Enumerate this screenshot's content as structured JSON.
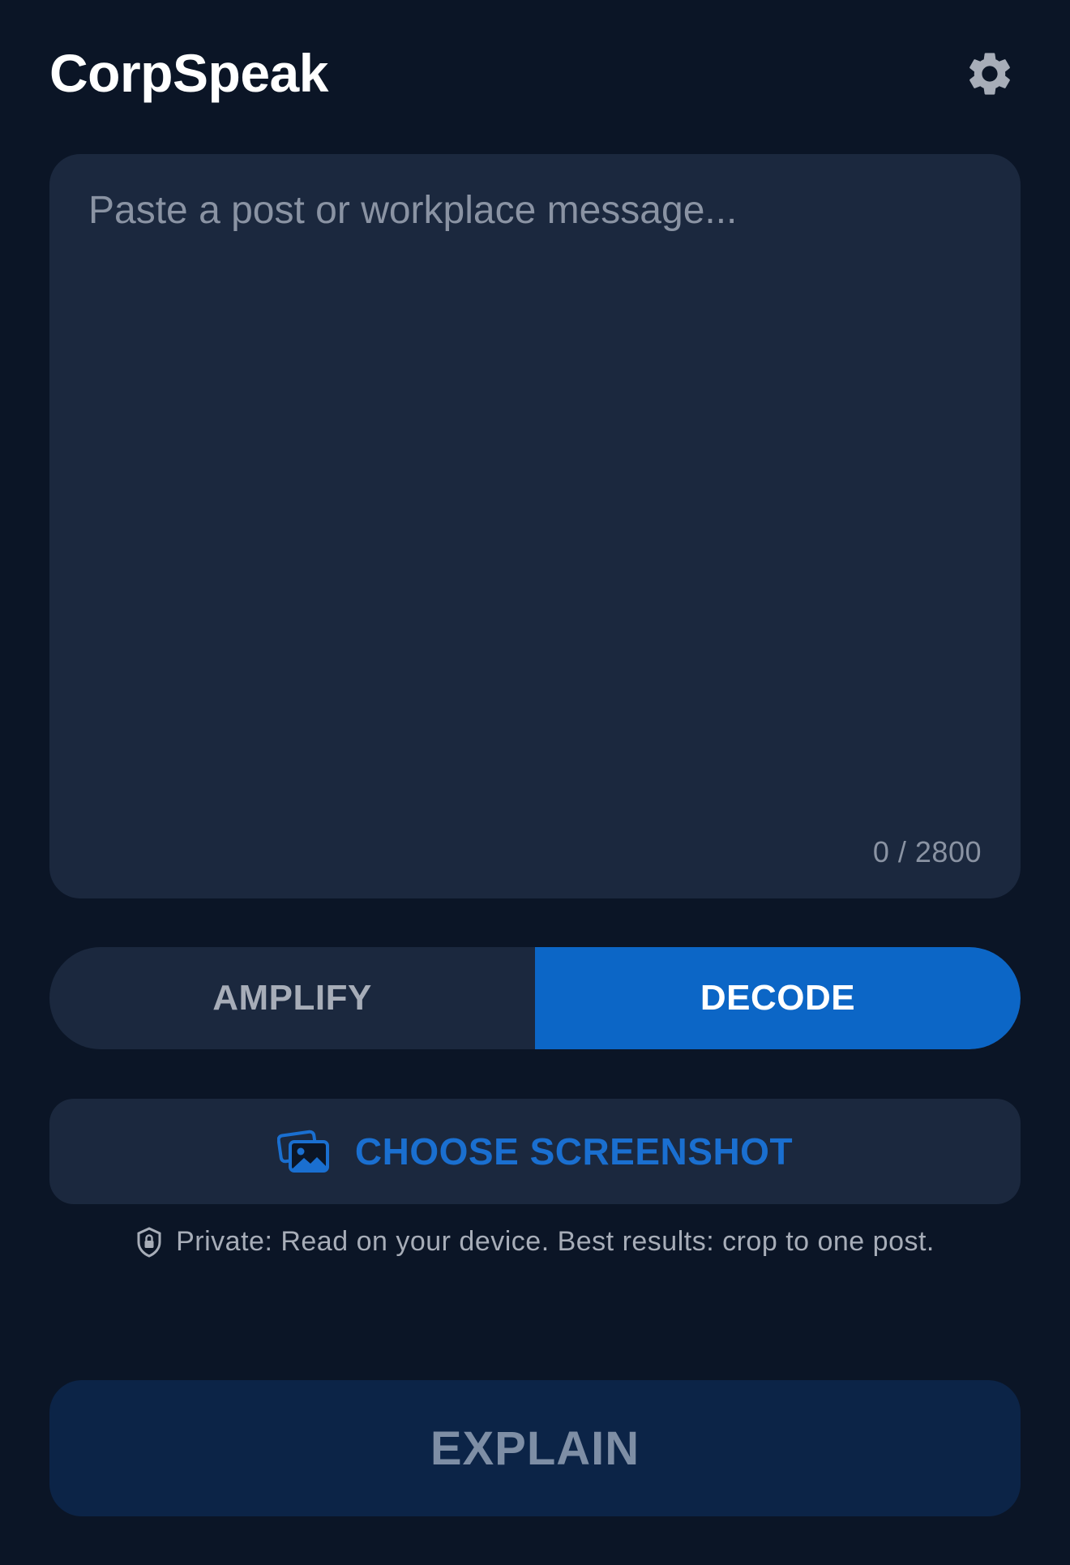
{
  "header": {
    "title": "CorpSpeak",
    "settings_icon": "gear-icon"
  },
  "editor": {
    "value": "",
    "placeholder": "Paste a post or workplace message...",
    "counter": "0 / 2800"
  },
  "mode_toggle": {
    "options": [
      {
        "label": "AMPLIFY",
        "selected": false
      },
      {
        "label": "DECODE",
        "selected": true
      }
    ]
  },
  "screenshot_button": {
    "icon": "photos-icon",
    "label": "CHOOSE SCREENSHOT"
  },
  "privacy_note": {
    "icon": "shield-lock-icon",
    "text": "Private: Read on your device. Best results: crop to one post."
  },
  "explain_button": {
    "label": "EXPLAIN"
  },
  "colors": {
    "background": "#0b1526",
    "card": "#1b283e",
    "accent": "#0c66c6",
    "accent_text": "#1a6fd0",
    "disabled_button": "#0c2447",
    "disabled_text": "#7e8ea5"
  }
}
